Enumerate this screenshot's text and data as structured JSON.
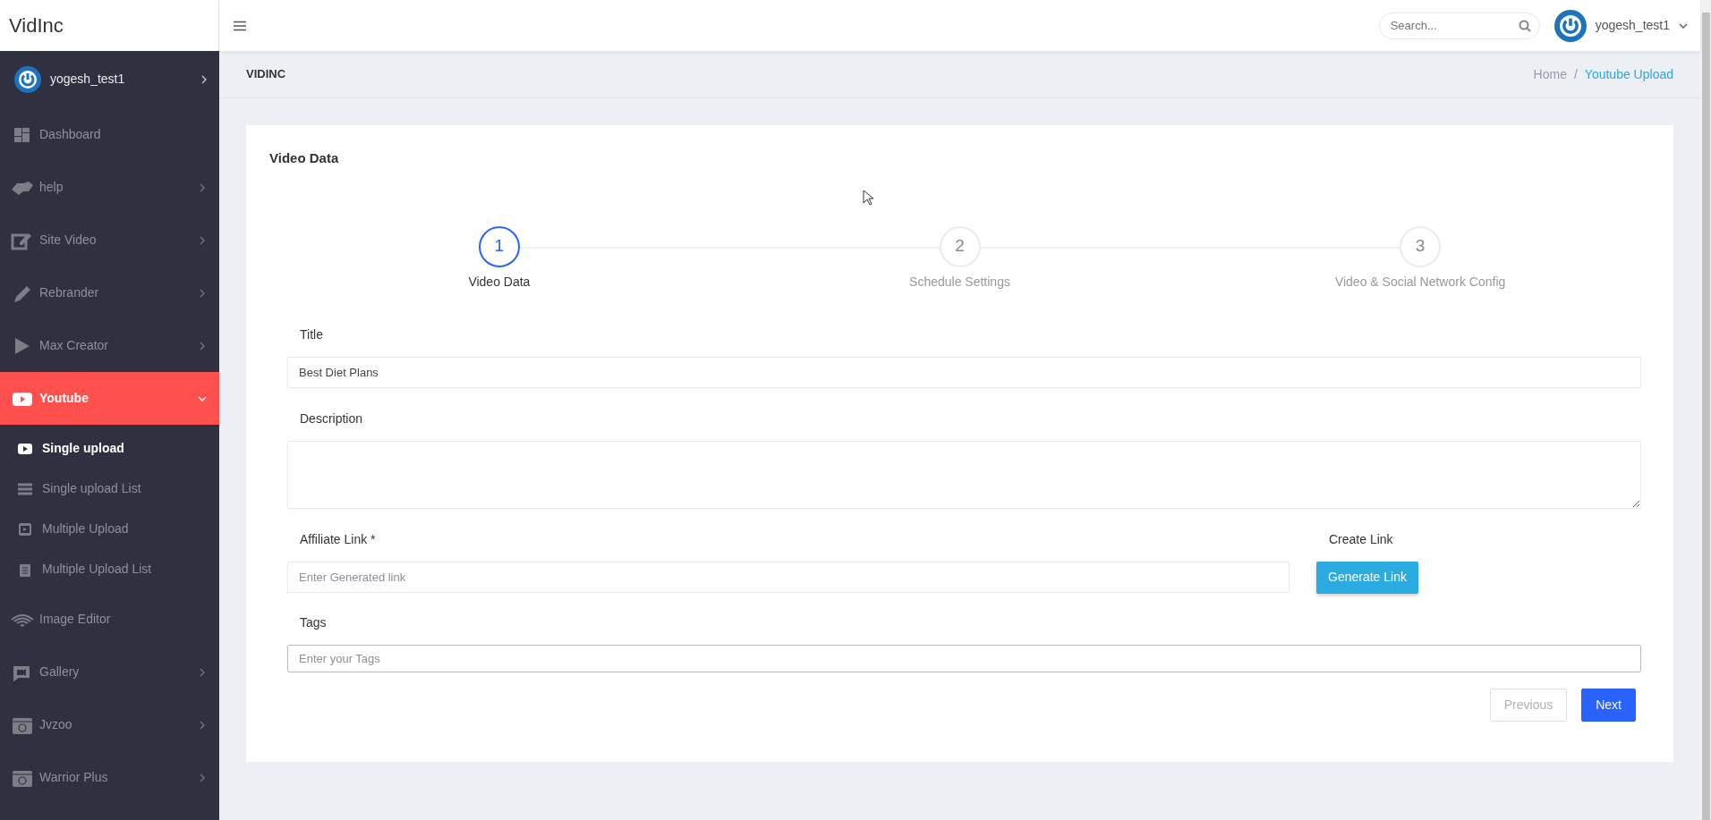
{
  "brand": "VidInc",
  "sidebar": {
    "user": {
      "name": "yogesh_test1"
    },
    "items": [
      {
        "label": "Dashboard",
        "selected": false
      },
      {
        "label": "help",
        "expandable": true,
        "expanded": false,
        "selected": false
      },
      {
        "label": "Site Video",
        "expandable": true,
        "expanded": false,
        "selected": false
      },
      {
        "label": "Rebrander",
        "expandable": true,
        "expanded": false,
        "selected": false
      },
      {
        "label": "Max Creator",
        "expandable": true,
        "expanded": false,
        "selected": false
      },
      {
        "label": "Youtube",
        "expandable": true,
        "expanded": true,
        "selected": true,
        "children": [
          {
            "label": "Single upload",
            "selected": true
          },
          {
            "label": "Single upload List",
            "selected": false
          },
          {
            "label": "Multiple Upload",
            "selected": false
          },
          {
            "label": "Multiple Upload List",
            "selected": false
          }
        ]
      },
      {
        "label": "Image Editor",
        "selected": false
      },
      {
        "label": "Gallery",
        "expandable": true,
        "expanded": false,
        "selected": false
      },
      {
        "label": "Jvzoo",
        "expandable": true,
        "expanded": false,
        "selected": false
      },
      {
        "label": "Warrior Plus",
        "expandable": true,
        "expanded": false,
        "selected": false
      }
    ]
  },
  "topbar": {
    "search": {
      "placeholder": "Search..."
    },
    "user": {
      "name": "yogesh_test1"
    }
  },
  "page_header": {
    "title": "VIDINC",
    "separator": "/",
    "breadcrumb": [
      {
        "label": "Home",
        "selected": false
      },
      {
        "label": "Youtube Upload",
        "selected": true
      }
    ]
  },
  "card": {
    "title": "Video Data",
    "steps": [
      {
        "number": "1",
        "label": "Video Data",
        "selected": true
      },
      {
        "number": "2",
        "label": "Schedule Settings",
        "selected": false
      },
      {
        "number": "3",
        "label": "Video & Social Network Config",
        "selected": false
      }
    ],
    "form": {
      "title": {
        "label": "Title",
        "value": "Best Diet Plans"
      },
      "description": {
        "label": "Description"
      },
      "affiliate_link": {
        "label": "Affiliate Link *",
        "placeholder": "Enter Generated link"
      },
      "create_link": {
        "label": "Create Link",
        "button": "Generate Link"
      },
      "tags": {
        "label": "Tags",
        "placeholder": "Enter your Tags"
      }
    },
    "buttons": [
      {
        "label": "Previous",
        "disabled": true
      },
      {
        "label": "Next",
        "disabled": false
      }
    ]
  }
}
